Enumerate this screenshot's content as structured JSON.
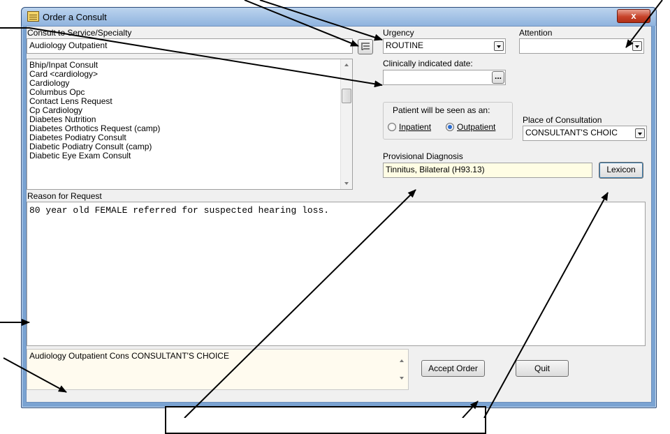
{
  "window": {
    "title": "Order a Consult",
    "close_glyph": "x"
  },
  "service": {
    "label": "Consult to Service/Specialty",
    "value": "Audiology Outpatient",
    "items": [
      "Bhip/Inpat Consult",
      "Card  <cardiology>",
      "Cardiology",
      "Columbus Opc",
      "Contact Lens Request",
      "Cp Cardiology",
      "Diabetes Nutrition",
      "Diabetes Orthotics Request (camp)",
      "Diabetes Podiatry Consult",
      "Diabetic Podiatry Consult (camp)",
      "Diabetic Eye Exam Consult"
    ]
  },
  "urgency": {
    "label": "Urgency",
    "value": "ROUTINE"
  },
  "attention": {
    "label": "Attention",
    "value": ""
  },
  "clinical_date": {
    "label": "Clinically indicated date:",
    "value": "",
    "button": "..."
  },
  "patient_seen": {
    "label": "Patient will be seen as an:",
    "inpatient": "Inpatient",
    "outpatient": "Outpatient",
    "selected": "Outpatient"
  },
  "place": {
    "label": "Place of Consultation",
    "value": "CONSULTANT'S CHOIC"
  },
  "provisional": {
    "label": "Provisional Diagnosis",
    "value": "Tinnitus, Bilateral (H93.13)",
    "lexicon_button": "Lexicon"
  },
  "reason": {
    "label": "Reason for Request",
    "text": "80 year old FEMALE referred for suspected hearing loss."
  },
  "summary": {
    "text": "Audiology Outpatient Cons CONSULTANT'S CHOICE"
  },
  "buttons": {
    "accept": "Accept Order",
    "quit": "Quit"
  },
  "colors": {
    "title_bar": "#9dbde4",
    "diagnosis_bg": "#fffde4",
    "summary_bg": "#fffbef",
    "close_button": "#c7432a"
  },
  "icons": [
    "order-form-icon",
    "close-icon",
    "tree-list-icon",
    "dropdown-arrow-icon",
    "scroll-up-icon",
    "scroll-down-icon"
  ]
}
